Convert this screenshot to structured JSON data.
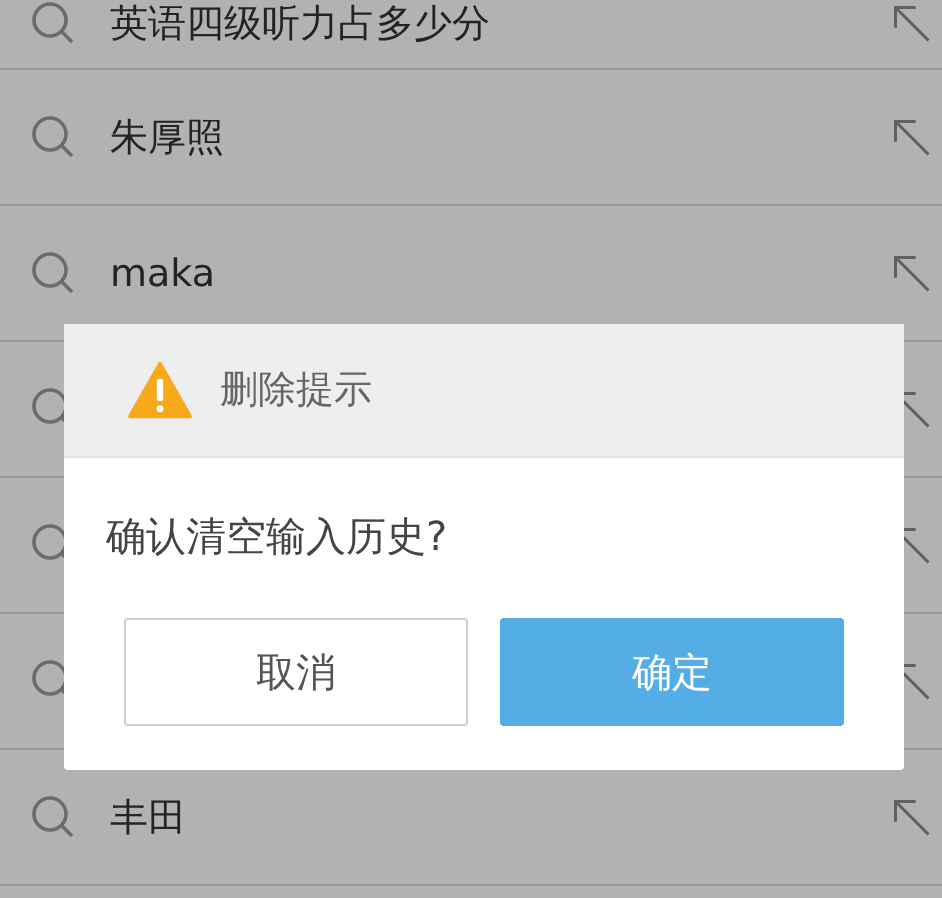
{
  "history": [
    {
      "kind": "entry",
      "query": "英语四级听力占多少分"
    },
    {
      "kind": "entry",
      "query": "朱厚照"
    },
    {
      "kind": "entry",
      "query": "maka"
    },
    {
      "kind": "covered"
    },
    {
      "kind": "covered"
    },
    {
      "kind": "covered"
    },
    {
      "kind": "entry",
      "query": "丰田"
    },
    {
      "kind": "blank"
    }
  ],
  "dialog": {
    "title": "删除提示",
    "message": "确认清空输入历史?",
    "buttons": [
      {
        "label": "取消",
        "kind": "secondary"
      },
      {
        "label": "确定",
        "kind": "primary"
      }
    ]
  }
}
